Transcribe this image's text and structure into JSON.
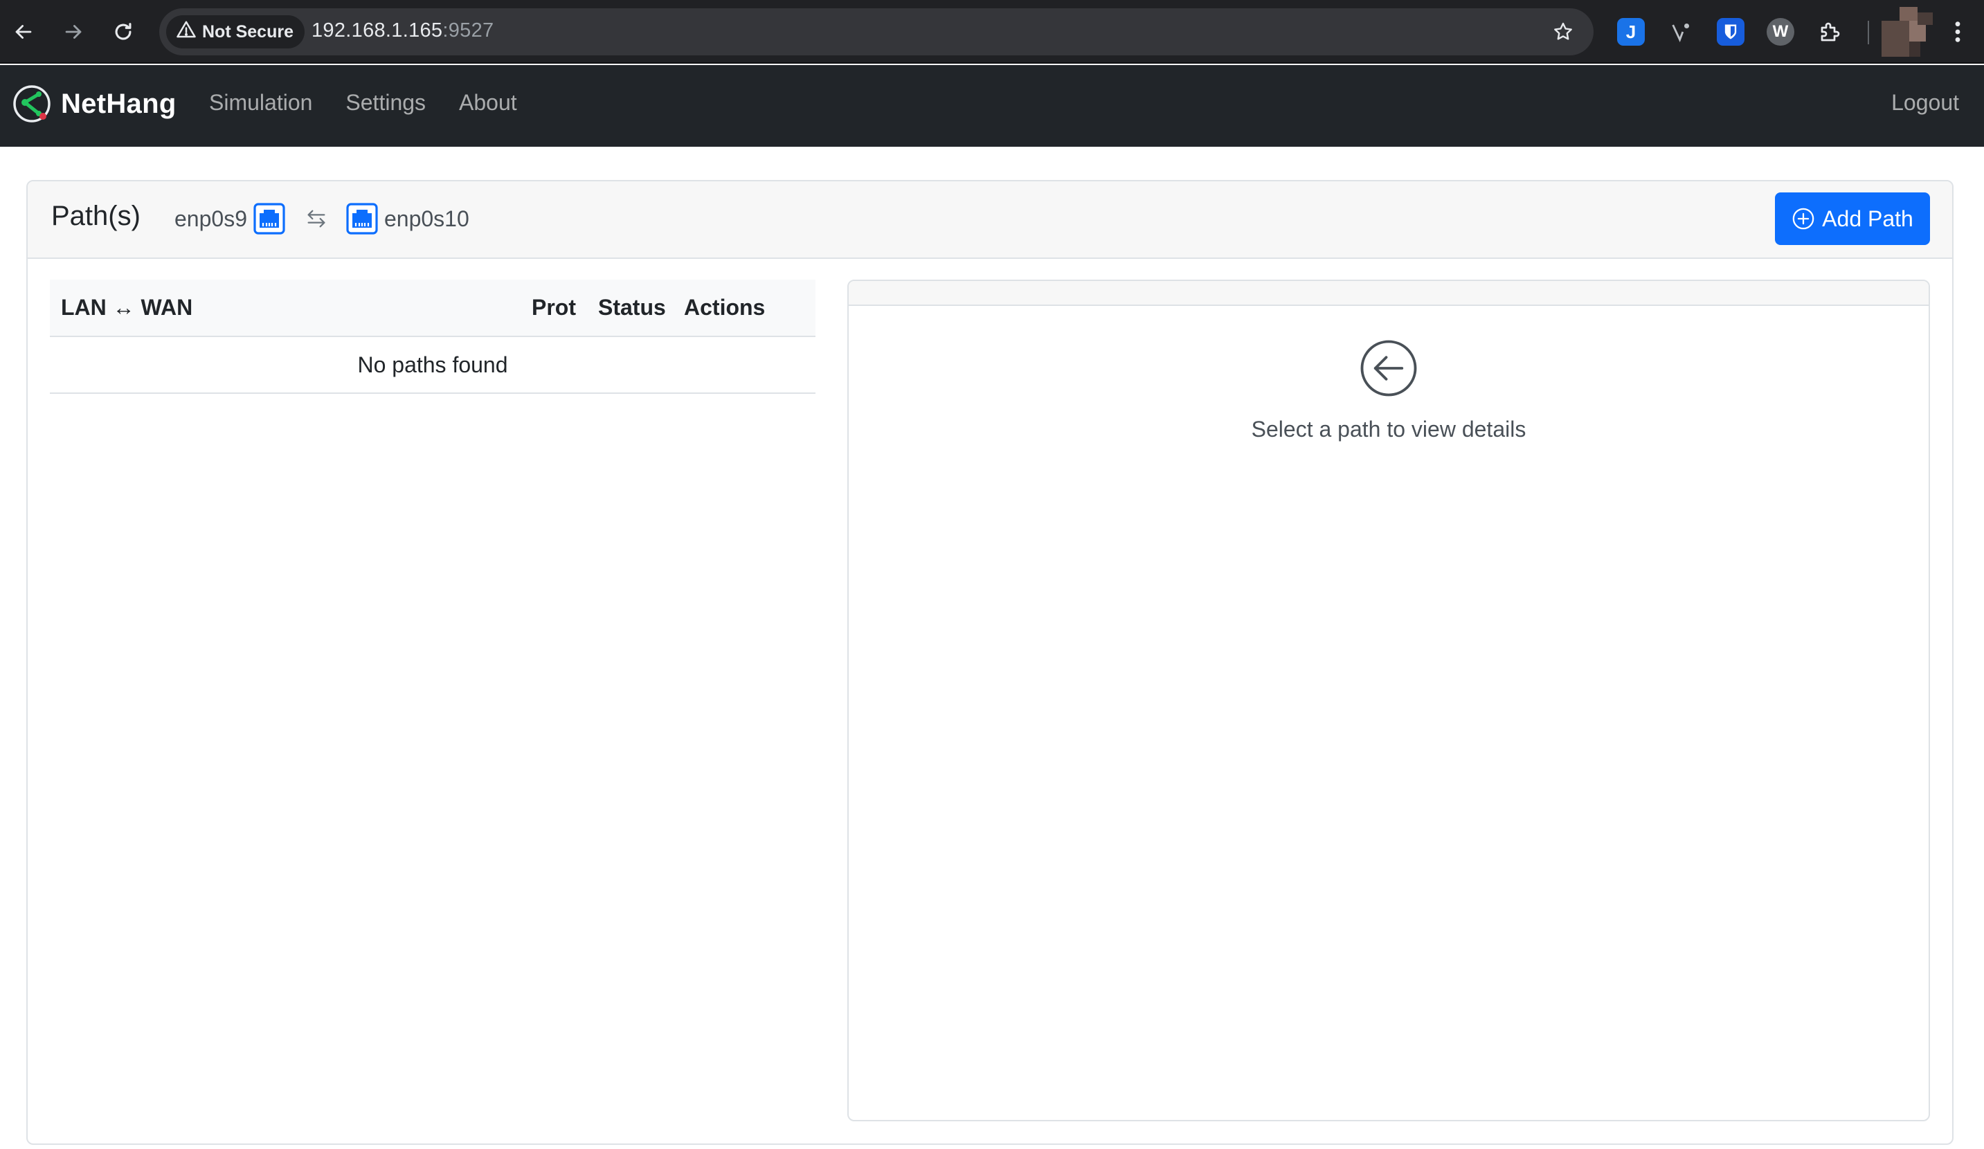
{
  "browser": {
    "security_label": "Not Secure",
    "url_host": "192.168.1.165",
    "url_port": ":9527",
    "extensions": [
      "j-extension-icon",
      "v-extension-icon",
      "bitwarden-icon",
      "w-extension-icon",
      "extensions-puzzle-icon"
    ]
  },
  "navbar": {
    "brand": "NetHang",
    "links": [
      "Simulation",
      "Settings",
      "About"
    ],
    "logout": "Logout"
  },
  "paths_card": {
    "title": "Path(s)",
    "lan_interface": "enp0s9",
    "wan_interface": "enp0s10",
    "add_button_label": "Add Path",
    "accent_color": "#0d6efd"
  },
  "paths_table": {
    "headers": {
      "lan_wan": "LAN ↔ WAN",
      "prot": "Prot",
      "status": "Status",
      "actions": "Actions"
    },
    "empty_message": "No paths found",
    "rows": []
  },
  "details_panel": {
    "empty_message": "Select a path to view details"
  }
}
